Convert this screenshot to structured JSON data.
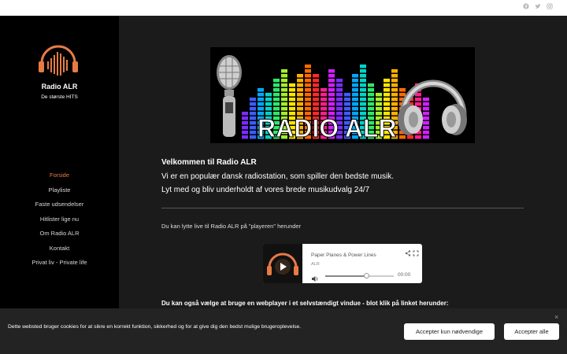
{
  "header": {
    "social": [
      {
        "icon": "facebook-icon"
      },
      {
        "icon": "twitter-icon"
      },
      {
        "icon": "instagram-icon"
      }
    ]
  },
  "sidebar": {
    "site_title": "Radio ALR",
    "site_subtitle": "De største HITS",
    "nav": [
      {
        "label": "Forside",
        "active": true
      },
      {
        "label": "Playliste",
        "active": false
      },
      {
        "label": "Faste udsendelser",
        "active": false
      },
      {
        "label": "Hitlister lige nu",
        "active": false
      },
      {
        "label": "Om Radio ALR",
        "active": false
      },
      {
        "label": "Kontakt",
        "active": false
      },
      {
        "label": "Privat liv - Private life",
        "active": false
      }
    ]
  },
  "main": {
    "banner_text": "RADIO ALR",
    "welcome_title": "Velkommen til Radio ALR",
    "welcome_lines": [
      "Vi er en populær dansk radiostation, som spiller den bedste musik.",
      "Lyt med og bliv underholdt af vores brede musikudvalg 24/7"
    ],
    "listen_text": "Du kan lytte live til Radio ALR på \"playeren\" herunder",
    "player": {
      "track_title": "Paper Planes & Power Lines",
      "artist": "ALR",
      "time": "00:00",
      "volume_fraction": 0.6
    },
    "webplayer_text": "Du kan også vælge at bruge en webplayer i et selvstændigt vindue - blot klik på linket herunder:"
  },
  "cookie": {
    "text": "Dette websted bruger cookies for at sikre en korrekt funktion, sikkerhed og for at give dig den bedst mulige brugeroplevelse.",
    "btn_necessary": "Accepter kun nødvendige",
    "btn_all": "Accepter alle",
    "close": "×"
  },
  "colors": {
    "accent": "#e77b44",
    "sidebar_bg": "#000000",
    "main_bg": "#1b1b1b"
  }
}
